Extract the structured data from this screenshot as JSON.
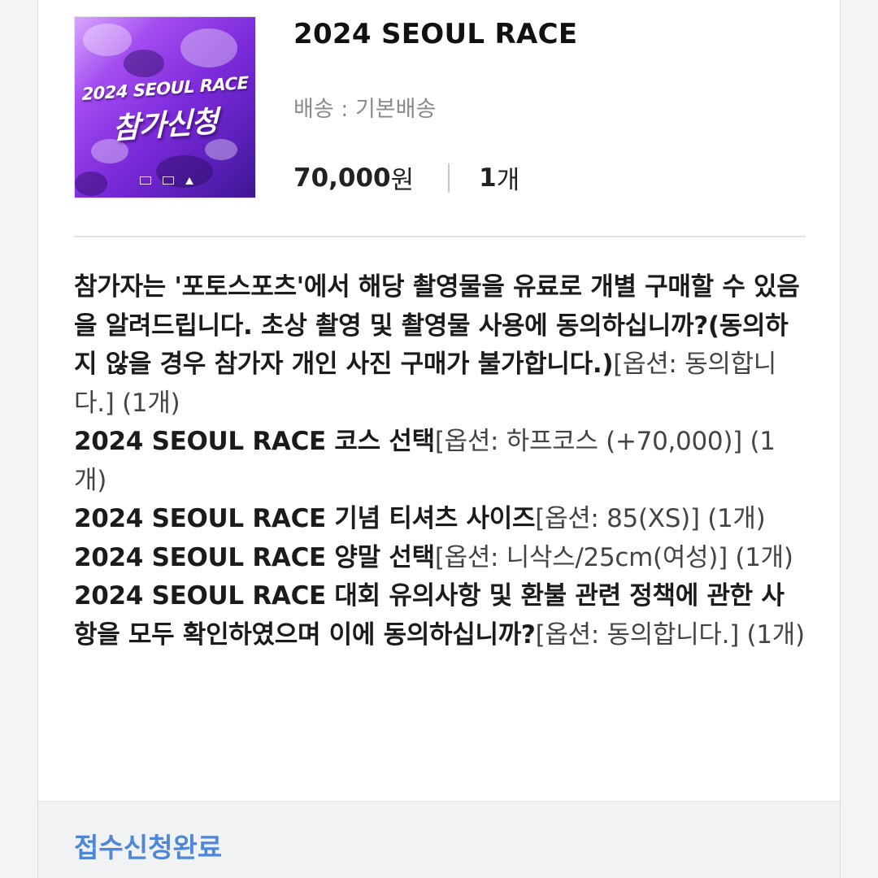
{
  "product": {
    "thumbnail": {
      "title": "2024 SEOUL RACE",
      "subtitle": "참가신청"
    },
    "title": "2024 SEOUL RACE",
    "shipping": "배송 : 기본배송",
    "price": "70,000",
    "price_unit": "원",
    "quantity": "1",
    "quantity_unit": "개"
  },
  "options": [
    {
      "name": "참가자는 '포토스포츠'에서 해당 촬영물을 유료로 개별 구매할 수 있음을 알려드립니다. 초상 촬영 및 촬영물 사용에 동의하십니까?(동의하지 않을 경우 참가자 개인 사진 구매가 불가합니다.)",
      "value": "[옵션: 동의합니다.] (1개)"
    },
    {
      "name": "2024 SEOUL RACE 코스 선택",
      "value": "[옵션: 하프코스 (+70,000)] (1개)"
    },
    {
      "name": "2024 SEOUL RACE 기념 티셔츠 사이즈",
      "value": "[옵션: 85(XS)] (1개)"
    },
    {
      "name": "2024 SEOUL RACE 양말 선택",
      "value": "[옵션: 니삭스/25cm(여성)] (1개)"
    },
    {
      "name": "2024 SEOUL RACE 대회 유의사항 및 환불 관련 정책에 관한 사항을 모두 확인하였으며 이에 동의하십니까?",
      "value": "[옵션: 동의합니다.] (1개)"
    }
  ],
  "status": "접수신청완료",
  "colors": {
    "status": "#4e86d8",
    "thumbnail_primary": "#7b2ad9"
  }
}
